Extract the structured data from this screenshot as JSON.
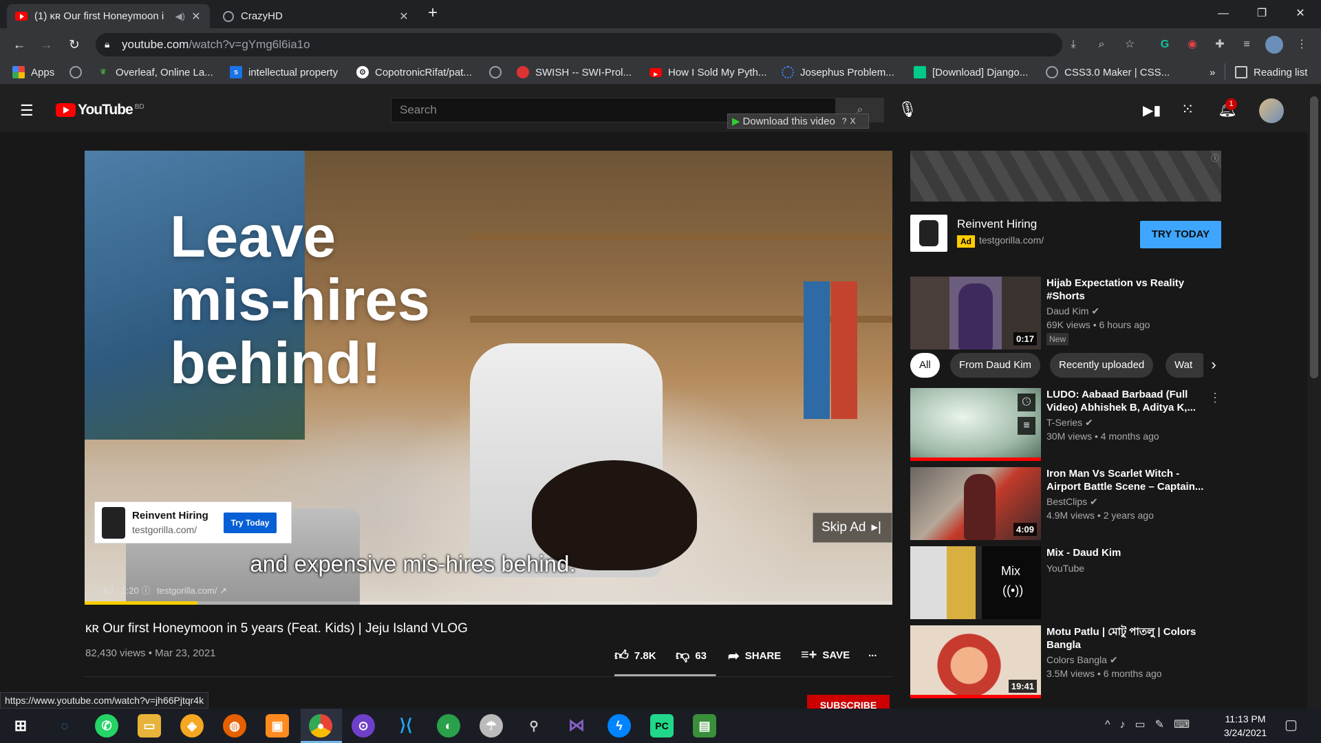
{
  "browser": {
    "tabs": [
      {
        "title": "(1) ĸʀ Our first Honeymoon i",
        "icon": "youtube-favicon",
        "active": true
      },
      {
        "title": "CrazyHD",
        "icon": "globe-favicon",
        "active": false
      }
    ],
    "new_tab": "+",
    "url_host": "youtube.com",
    "url_path": "/watch?v=gYmg6l6ia1o",
    "status_url": "https://www.youtube.com/watch?v=jh66Pjtqr4k",
    "bookmarks": [
      {
        "label": "Apps",
        "icon": "apps-grid-icon",
        "color": "#4285f4"
      },
      {
        "label": "",
        "icon": "globe-icon",
        "color": "#9aa0a6"
      },
      {
        "label": "Overleaf, Online La...",
        "icon": "overleaf-icon",
        "color": "#47a141"
      },
      {
        "label": "intellectual property",
        "icon": "bookmark-s-icon",
        "color": "#1a73e8"
      },
      {
        "label": "CopotronicRifat/pat...",
        "icon": "github-icon",
        "color": "#ffffff"
      },
      {
        "label": "",
        "icon": "globe-icon",
        "color": "#9aa0a6"
      },
      {
        "label": "SWISH -- SWI-Prol...",
        "icon": "swish-icon",
        "color": "#d33"
      },
      {
        "label": "How I Sold My Pyth...",
        "icon": "youtube-icon",
        "color": "#ff0000"
      },
      {
        "label": "Josephus Problem...",
        "icon": "loading-icon",
        "color": "#4285f4"
      },
      {
        "label": "[Download] Django...",
        "icon": "django-icon",
        "color": "#0c8"
      },
      {
        "label": "CSS3.0 Maker | CSS...",
        "icon": "globe-icon",
        "color": "#9aa0a6"
      }
    ],
    "more_bookmarks": "»",
    "reading_list": "Reading list"
  },
  "youtube": {
    "logo_text": "YouTube",
    "country": "BD",
    "search_placeholder": "Search",
    "download_btn": "Download this video",
    "download_help": "?",
    "download_close": "X",
    "notif_count": "1",
    "player": {
      "ad_headline": [
        "Leave",
        "mis-hires",
        "behind!"
      ],
      "caption": "and expensive mis-hires behind.",
      "ad_card_name": "Reinvent Hiring",
      "ad_card_url": "testgorilla.com/",
      "ad_card_btn": "Try Today",
      "skip_label": "Skip Ad",
      "ad_info_label": "Ad · 1:20",
      "ad_info_url": "testgorilla.com/",
      "progress": 0.14
    },
    "video": {
      "title": "ĸʀ Our first Honeymoon in 5 years (Feat. Kids) | Jeju Island VLOG",
      "meta": "82,430 views • Mar 23, 2021",
      "likes": "7.8K",
      "dislikes": "63",
      "like_ratio": 0.99,
      "share": "SHARE",
      "save": "SAVE",
      "more": "...",
      "subscribe": "SUBSCRIBE"
    },
    "sidebar_ad": {
      "name": "Reinvent Hiring",
      "ad_badge": "Ad",
      "url": "testgorilla.com/",
      "cta": "TRY TODAY"
    },
    "first_video": {
      "title": "Hijab Expectation vs Reality #Shorts",
      "channel": "Daud Kim",
      "views": "69K views • 6 hours ago",
      "badge": "New",
      "duration": "0:17"
    },
    "chips": [
      "All",
      "From Daud Kim",
      "Recently uploaded",
      "Wat"
    ],
    "videos": [
      {
        "title": "LUDO: Aabaad Barbaad (Full Video) Abhishek B, Aditya K,...",
        "channel": "T-Series",
        "views": "30M views • 4 months ago",
        "duration": "",
        "watched": 1.0,
        "verified": true
      },
      {
        "title": "Iron Man Vs Scarlet Witch - Airport Battle Scene – Captain...",
        "channel": "BestClips",
        "views": "4.9M views • 2 years ago",
        "duration": "4:09",
        "watched": 0,
        "verified": true
      },
      {
        "title": "Mix - Daud Kim",
        "channel": "YouTube",
        "views": "",
        "duration": "",
        "mix_label": "Mix",
        "watched": 0,
        "verified": false
      },
      {
        "title": "Motu Patlu | মোটু পাতলু | Colors Bangla",
        "channel": "Colors Bangla",
        "views": "3.5M views • 6 months ago",
        "duration": "19:41",
        "watched": 1.0,
        "verified": true
      }
    ]
  },
  "taskbar": {
    "time": "11:13 PM",
    "date": "3/24/2021"
  },
  "colors": {
    "yt_red": "#ff0000",
    "link_blue": "#3ea6ff",
    "ad_yellow": "#ffcc00"
  }
}
